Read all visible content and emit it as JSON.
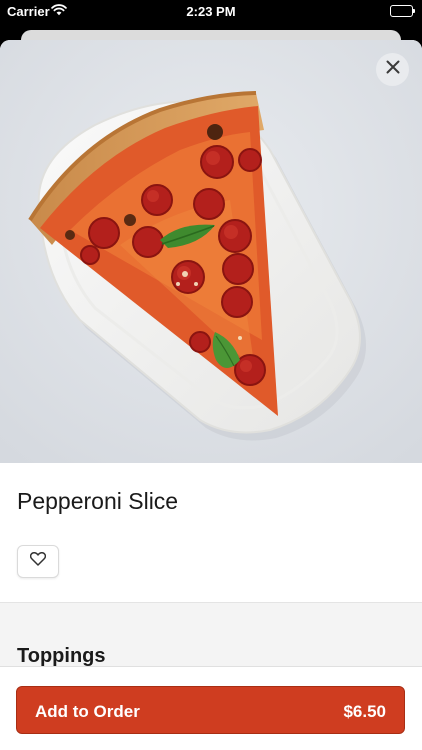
{
  "status": {
    "carrier": "Carrier",
    "time": "2:23 PM"
  },
  "product": {
    "title": "Pepperoni Slice"
  },
  "sections": {
    "toppings": "Toppings"
  },
  "cta": {
    "label": "Add to Order",
    "price": "$6.50"
  },
  "icons": {
    "close": "close-icon",
    "favorite": "heart-icon",
    "wifi": "wifi-icon",
    "battery": "battery-icon"
  },
  "colors": {
    "accent": "#cf3d20"
  }
}
